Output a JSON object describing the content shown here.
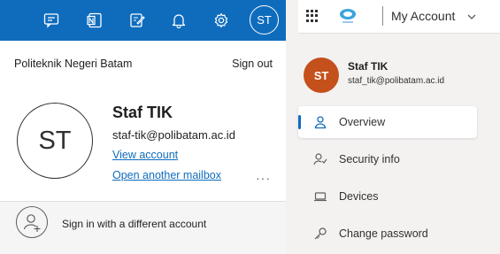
{
  "flyout": {
    "toolbar": {
      "icons": [
        "feedback-icon",
        "onenote-icon",
        "notes-icon",
        "bell-icon",
        "gear-icon"
      ],
      "avatar_initials": "ST"
    },
    "org_name": "Politeknik Negeri Batam",
    "sign_out": "Sign out",
    "avatar_initials": "ST",
    "user_name": "Staf TIK",
    "user_email": "staf-tik@polibatam.ac.id",
    "view_account": "View account",
    "open_mailbox": "Open another mailbox",
    "more": "···",
    "sign_in_other": "Sign in with a different account",
    "accent": "#0f6cbd"
  },
  "account": {
    "title": "My Account",
    "avatar_initials": "ST",
    "avatar_color": "#c4501b",
    "user_name": "Staf TIK",
    "user_email": "staf_tik@polibatam.ac.id",
    "nav": [
      {
        "label": "Overview",
        "icon": "person-icon",
        "active": true
      },
      {
        "label": "Security info",
        "icon": "security-info-icon",
        "active": false
      },
      {
        "label": "Devices",
        "icon": "laptop-icon",
        "active": false
      },
      {
        "label": "Change password",
        "icon": "key-icon",
        "active": false
      }
    ]
  }
}
